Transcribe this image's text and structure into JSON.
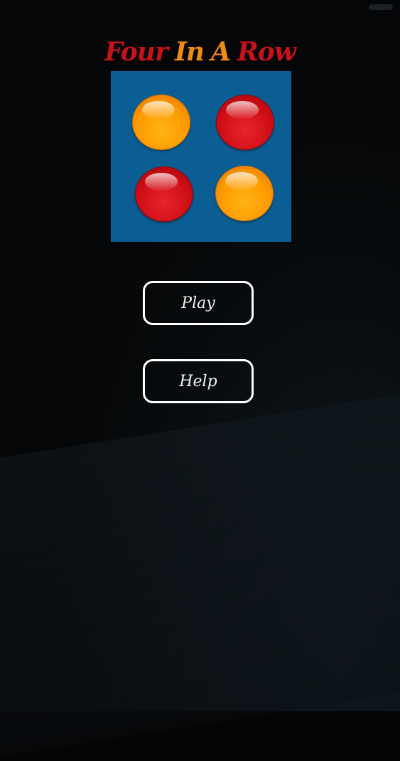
{
  "title": {
    "words": [
      "Four",
      "In",
      "A",
      "Row"
    ],
    "word_colors": [
      "#c8121a",
      "#ef8a12",
      "#ef8a12",
      "#c8121a"
    ]
  },
  "logo_board": {
    "background": "#0b5e94",
    "discs": [
      {
        "color": "orange"
      },
      {
        "color": "red"
      },
      {
        "color": "red"
      },
      {
        "color": "orange"
      }
    ]
  },
  "menu": {
    "play_label": "Play",
    "help_label": "Help"
  }
}
